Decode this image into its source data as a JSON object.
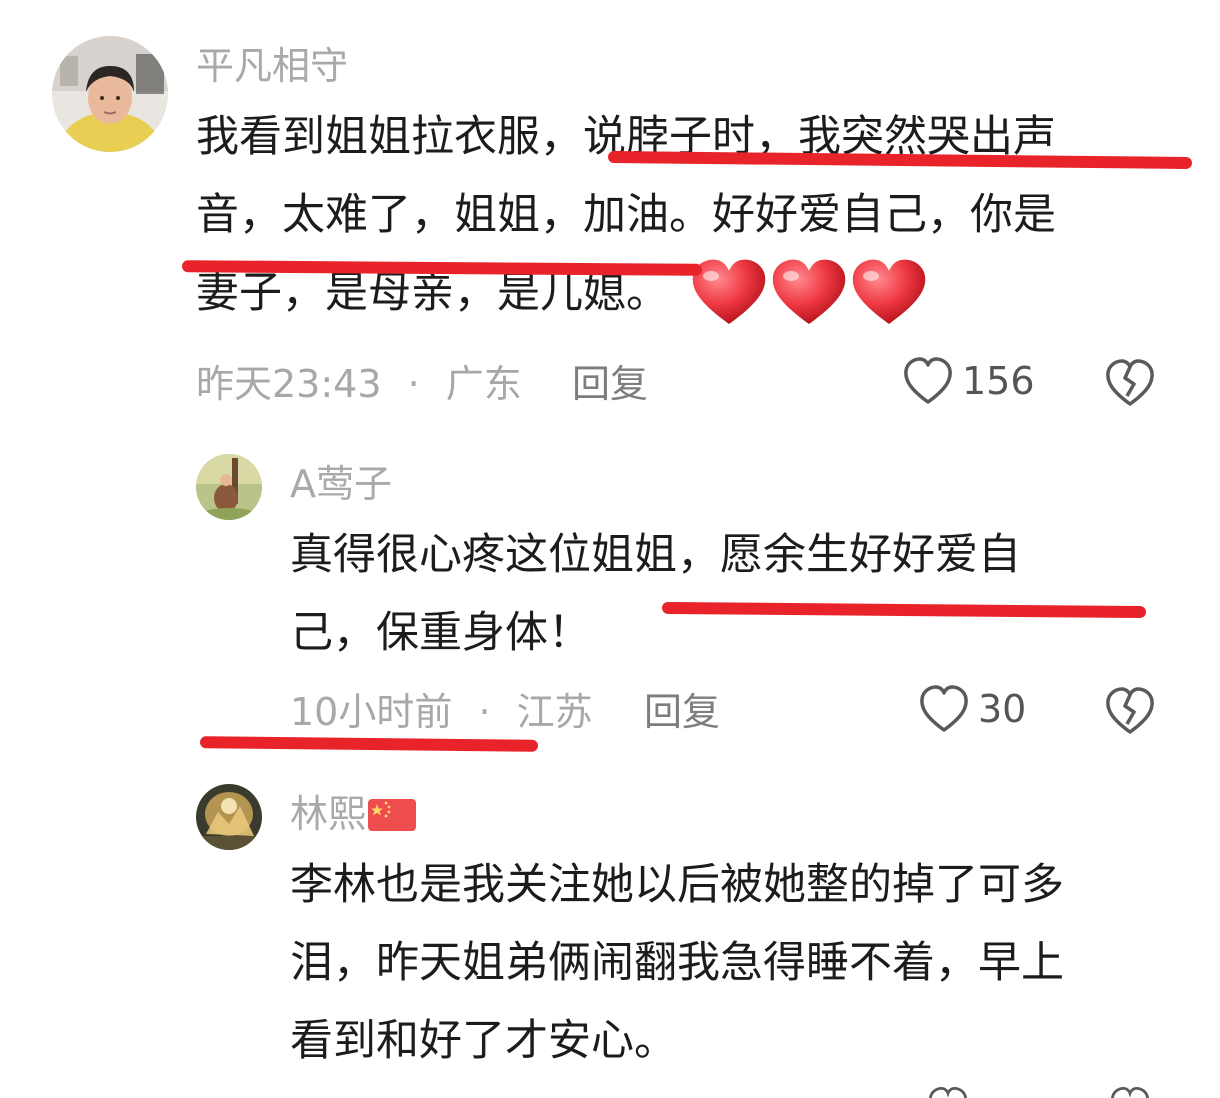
{
  "colors": {
    "underline": "#e8232a",
    "flag_red": "#ee4d4d",
    "flag_star": "#ffd76a",
    "heart_emoji": "#f03a44"
  },
  "comments": [
    {
      "username": "平凡相守",
      "text_line_1": "我看到姐姐拉衣服，说脖子时，我突然哭出声",
      "text_line_2": "音，太难了，姐姐，加油。好好爱自己，你是",
      "text_line_3": "妻子，是母亲，是儿媳。",
      "emojis": [
        "heart-emoji",
        "heart-emoji",
        "heart-emoji"
      ],
      "time": "昨天23:43",
      "separator": "·",
      "location": "广东",
      "reply_label": "回复",
      "likes": "156"
    },
    {
      "username": "A莺子",
      "text_line_1": "真得很心疼这位姐姐，愿余生好好爱自",
      "text_line_2": "己，保重身体！",
      "time": "10小时前",
      "separator": "·",
      "location": "江苏",
      "reply_label": "回复",
      "likes": "30"
    },
    {
      "username": "林熙",
      "flag": "china-flag-icon",
      "text_line_1": "李林也是我关注她以后被她整的掉了可多",
      "text_line_2": "泪，昨天姐弟俩闹翻我急得睡不着，早上",
      "text_line_3": "看到和好了才安心。"
    }
  ]
}
